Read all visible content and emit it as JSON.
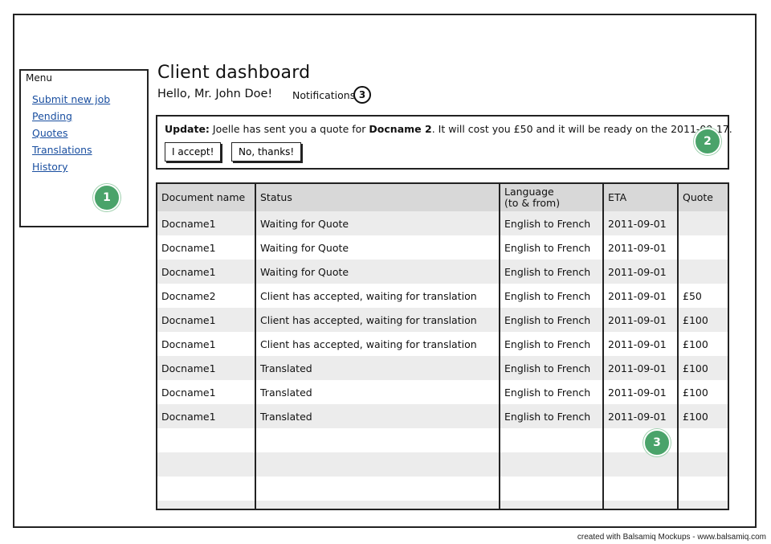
{
  "menu": {
    "title": "Menu",
    "items": [
      {
        "label": "Submit new job"
      },
      {
        "label": "Pending"
      },
      {
        "label": "Quotes"
      },
      {
        "label": "Translations"
      },
      {
        "label": "History"
      }
    ]
  },
  "header": {
    "title": "Client dashboard",
    "greeting": "Hello, Mr. John Doe!",
    "notifications_label": "Notifications",
    "notifications_count": "3"
  },
  "update": {
    "label": "Update:",
    "text_before": " Joelle has sent you a quote for ",
    "doc_name": "Docname 2",
    "text_after": ". It will cost you £50 and it will be ready on the 2011-09-17.",
    "accept_label": "I accept!",
    "decline_label": "No, thanks!"
  },
  "annotations": {
    "one": "1",
    "two": "2",
    "three": "3"
  },
  "table": {
    "columns": [
      {
        "label": "Document name"
      },
      {
        "label": "Status"
      },
      {
        "label": "Language\n(to & from)"
      },
      {
        "label": "ETA"
      },
      {
        "label": "Quote"
      }
    ],
    "rows": [
      [
        "Docname1",
        "Waiting for Quote",
        "English to French",
        "2011-09-01",
        ""
      ],
      [
        "Docname1",
        "Waiting for Quote",
        "English to French",
        "2011-09-01",
        ""
      ],
      [
        "Docname1",
        "Waiting for Quote",
        "English to French",
        "2011-09-01",
        ""
      ],
      [
        "Docname2",
        "Client has accepted, waiting for translation",
        "English to French",
        "2011-09-01",
        "£50"
      ],
      [
        "Docname1",
        "Client has accepted, waiting for translation",
        "English to French",
        "2011-09-01",
        "£100"
      ],
      [
        "Docname1",
        "Client has accepted, waiting for translation",
        "English to French",
        "2011-09-01",
        "£100"
      ],
      [
        "Docname1",
        "Translated",
        "English to French",
        "2011-09-01",
        "£100"
      ],
      [
        "Docname1",
        "Translated",
        "English to French",
        "2011-09-01",
        "£100"
      ],
      [
        "Docname1",
        "Translated",
        "English to French",
        "2011-09-01",
        "£100"
      ],
      [
        "",
        "",
        "",
        "",
        ""
      ],
      [
        "",
        "",
        "",
        "",
        ""
      ],
      [
        "",
        "",
        "",
        "",
        ""
      ],
      [
        "",
        "",
        "",
        "",
        ""
      ]
    ]
  },
  "footer": {
    "note": "created with Balsamiq Mockups - www.balsamiq.com"
  },
  "colors": {
    "annotation_badge": "#4aa36a",
    "link": "#1a4fa0",
    "header_row": "#d8d8d8",
    "stripe_row": "#ececec"
  }
}
